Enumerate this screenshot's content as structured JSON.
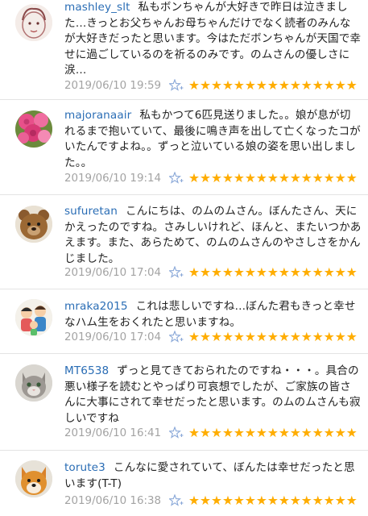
{
  "comments": [
    {
      "username": "mashley_slt",
      "text": "私もボンちゃんが大好きで昨日は泣きました…きっとお父ちゃんお母ちゃんだけでなく読者のみんなが大好きだったと思います。今はただボンちゃんが天国で幸せに過ごしているのを祈るのみです。のムさんの優しさに涙…",
      "date": "2019/06/10 19:59",
      "stars": "★★★★★★★★★★★★★★★",
      "avatar_icon": "sketch-face-avatar"
    },
    {
      "username": "majoranaair",
      "text": "私もかつて6匹見送りました。。娘が息が切れるまで抱いていて、最後に鳴き声を出して亡くなったコがいたんですよね。。ずっと泣いている娘の姿を思い出しました。。",
      "date": "2019/06/10 19:14",
      "stars": "★★★★★★★★★★★★★★★",
      "avatar_icon": "pink-roses-avatar"
    },
    {
      "username": "sufuretan",
      "text": "こんにちは、のムのムさん。ぼんたさん、天にかえったのですね。さみしいけれど、ほんと、またいつかあえます。また、あらためて、のムのムさんのやさしさをかんじました。",
      "date": "2019/06/10 17:04",
      "stars": "★★★★★★★★★★★★★★★",
      "avatar_icon": "teddy-bear-avatar"
    },
    {
      "username": "mraka2015",
      "text": "これは悲しいですね…ぼんた君もきっと幸せなハム生をおくれたと思いますね。",
      "date": "2019/06/10 17:04",
      "stars": "★★★★★★★★★★★★★★★",
      "avatar_icon": "family-cartoon-avatar"
    },
    {
      "username": "MT6538",
      "text": "ずっと見てきておられたのですね・・・。具合の悪い様子を読むとやっぱり可哀想でしたが、ご家族の皆さんに大事にされて幸せだったと思います。のムのムさんも寂しいですね",
      "date": "2019/06/10 16:41",
      "stars": "★★★★★★★★★★★★★★★",
      "avatar_icon": "grey-cat-avatar"
    },
    {
      "username": "torute3",
      "text": "こんなに愛されていて、ぼんたは幸せだったと思います(T-T)",
      "date": "2019/06/10 16:38",
      "stars": "★★★★★★★★★★★★★★★",
      "avatar_icon": "shiba-dog-avatar"
    }
  ]
}
